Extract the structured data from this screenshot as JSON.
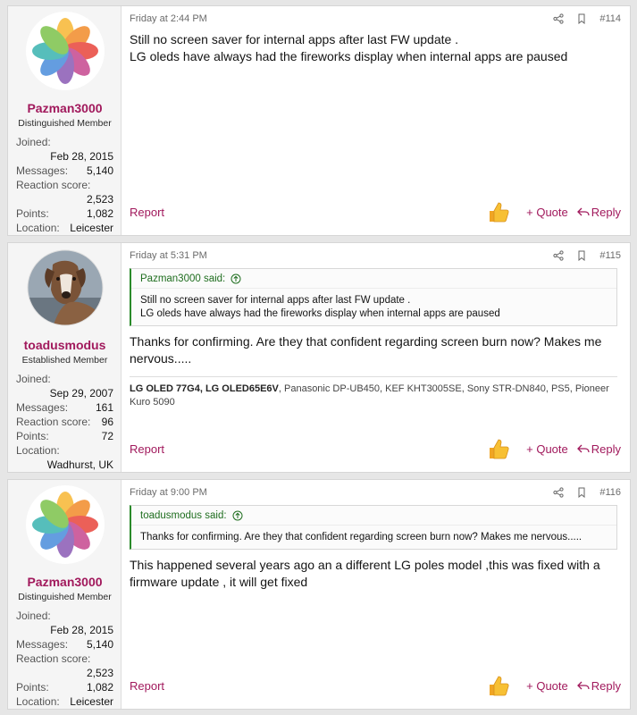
{
  "posts": [
    {
      "username": "Pazman3000",
      "user_title": "Distinguished Member",
      "stats": {
        "joined_label": "Joined:",
        "joined": "Feb 28, 2015",
        "messages_label": "Messages:",
        "messages": "5,140",
        "reaction_label": "Reaction score:",
        "reaction": "2,523",
        "points_label": "Points:",
        "points": "1,082",
        "location_label": "Location:",
        "location": "Leicester"
      },
      "date": "Friday at 2:44 PM",
      "number": "#114",
      "lines": [
        "Still no screen saver for internal apps after last FW update .",
        "LG oleds have always had the fireworks display when internal apps are paused"
      ]
    },
    {
      "username": "toadusmodus",
      "user_title": "Established Member",
      "stats": {
        "joined_label": "Joined:",
        "joined": "Sep 29, 2007",
        "messages_label": "Messages:",
        "messages": "161",
        "reaction_label": "Reaction score:",
        "reaction": "96",
        "points_label": "Points:",
        "points": "72",
        "location_label": "Location:",
        "location": "Wadhurst, UK"
      },
      "date": "Friday at 5:31 PM",
      "number": "#115",
      "quote": {
        "author": "Pazman3000 said:",
        "lines": [
          "Still no screen saver for internal apps after last FW update .",
          "LG oleds have always had the fireworks display when internal apps are paused"
        ]
      },
      "text": "Thanks for confirming. Are they that confident regarding screen burn now? Makes me nervous.....",
      "signature": {
        "bold": "LG OLED 77G4, LG OLED65E6V",
        "rest": ", Panasonic DP-UB450, KEF KHT3005SE, Sony STR-DN840, PS5, Pioneer Kuro 5090"
      }
    },
    {
      "username": "Pazman3000",
      "user_title": "Distinguished Member",
      "stats": {
        "joined_label": "Joined:",
        "joined": "Feb 28, 2015",
        "messages_label": "Messages:",
        "messages": "5,140",
        "reaction_label": "Reaction score:",
        "reaction": "2,523",
        "points_label": "Points:",
        "points": "1,082",
        "location_label": "Location:",
        "location": "Leicester"
      },
      "date": "Friday at 9:00 PM",
      "number": "#116",
      "quote": {
        "author": "toadusmodus said:",
        "lines": [
          "Thanks for confirming. Are they that confident regarding screen burn now? Makes me nervous....."
        ]
      },
      "text": "This happened several years ago an a different LG poles model ,this was fixed with a firmware update , it will get fixed"
    }
  ],
  "actions": {
    "report": "Report",
    "quote": "+ Quote",
    "reply": "Reply"
  },
  "icons": {
    "share": "share-icon",
    "bookmark": "bookmark-icon",
    "like": "thumbs-up-icon",
    "reply": "reply-arrow-icon",
    "quote_up": "arrow-up-circle-icon"
  },
  "colors": {
    "accent": "#a1195c",
    "quote_border": "#2a8a2a"
  }
}
